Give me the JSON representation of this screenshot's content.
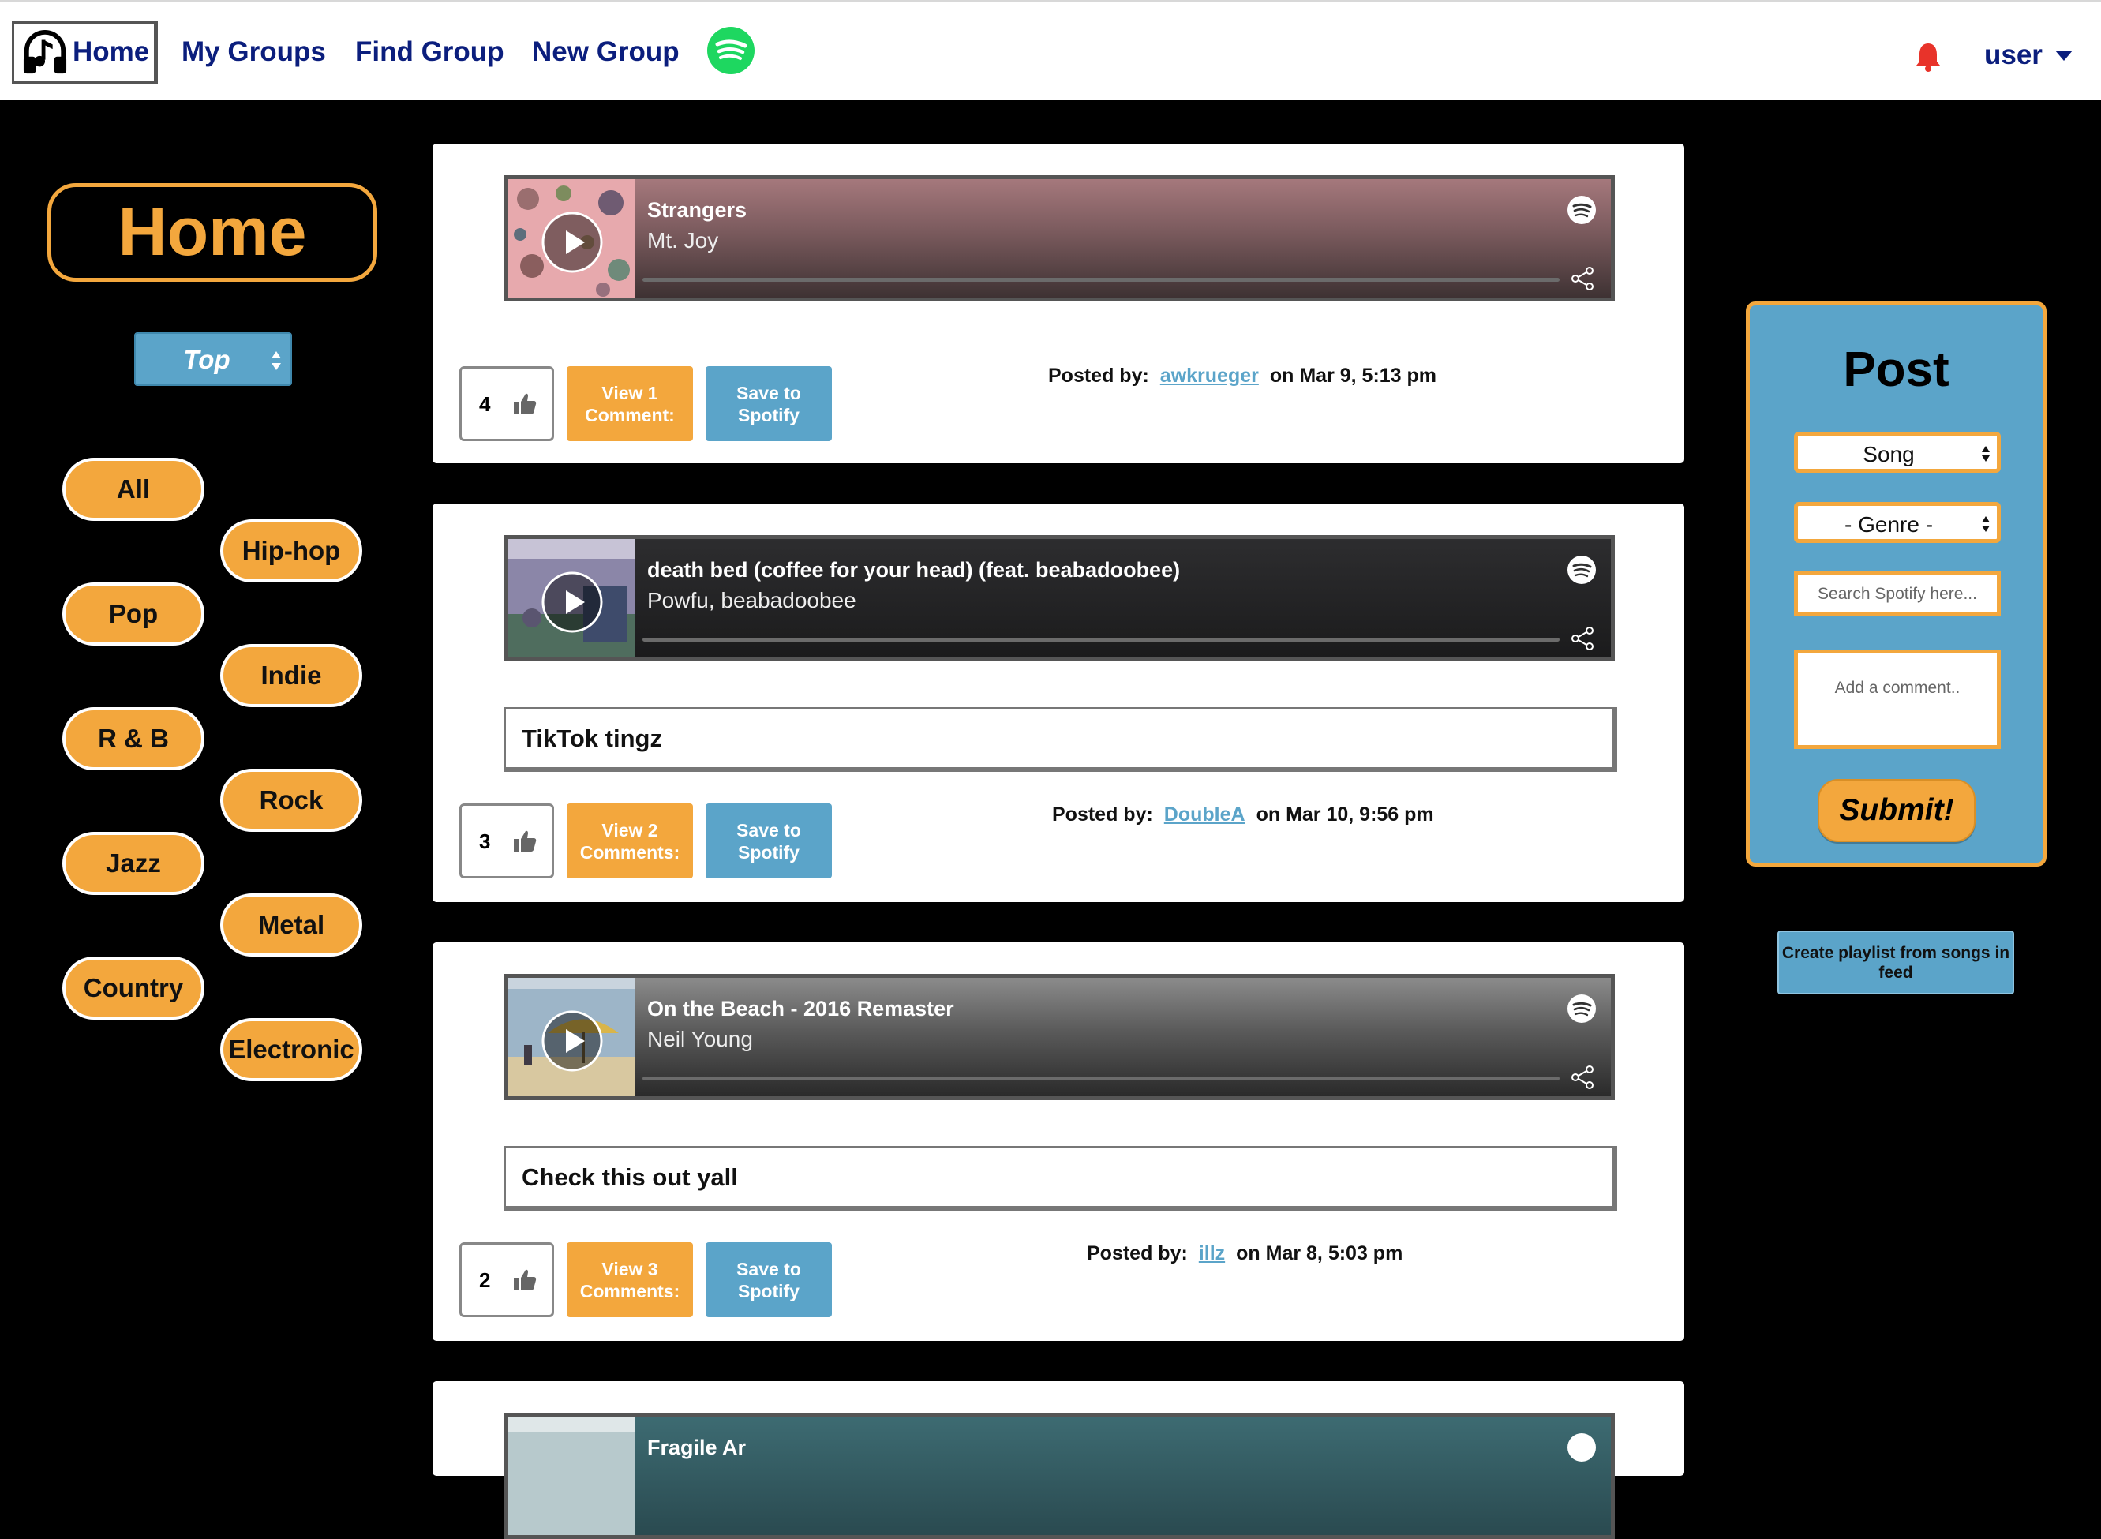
{
  "nav": {
    "home": "Home",
    "my_groups": "My Groups",
    "find_group": "Find Group",
    "new_group": "New Group",
    "user": "user"
  },
  "sidebar": {
    "title": "Home",
    "sort": "Top",
    "genres": [
      "All",
      "Hip-hop",
      "Pop",
      "Indie",
      "R & B",
      "Rock",
      "Jazz",
      "Metal",
      "Country",
      "Electronic"
    ]
  },
  "posts": [
    {
      "track": "Strangers",
      "artist": "Mt. Joy",
      "caption": "",
      "likes": "4",
      "comments_label": "View 1 Comment:",
      "save_label": "Save to Spotify",
      "posted_prefix": "Posted by:",
      "user": "awkrueger",
      "date": "on Mar 9, 5:13 pm"
    },
    {
      "track": "death bed (coffee for your head) (feat. beabadoobee)",
      "artist": "Powfu, beabadoobee",
      "caption": "TikTok tingz",
      "likes": "3",
      "comments_label": "View 2 Comments:",
      "save_label": "Save to Spotify",
      "posted_prefix": "Posted by:",
      "user": "DoubleA",
      "date": "on Mar 10, 9:56 pm"
    },
    {
      "track": "On the Beach - 2016 Remaster",
      "artist": "Neil Young",
      "caption": "Check this out yall",
      "likes": "2",
      "comments_label": "View 3 Comments:",
      "save_label": "Save to Spotify",
      "posted_prefix": "Posted by:",
      "user": "illz",
      "date": "on Mar 8, 5:03 pm"
    },
    {
      "track": "Fragile Ar"
    }
  ],
  "post_panel": {
    "title": "Post",
    "type": "Song",
    "genre": "- Genre -",
    "search_placeholder": "Search Spotify here...",
    "comment_placeholder": "Add a comment..",
    "submit": "Submit!"
  },
  "playlist_button": "Create playlist from songs in feed",
  "colors": {
    "accent_orange": "#f3a73d",
    "accent_blue": "#5ba4c9",
    "nav_text": "#0b1e7d",
    "spotify_green": "#1ed760",
    "bell_red": "#e8332a"
  }
}
